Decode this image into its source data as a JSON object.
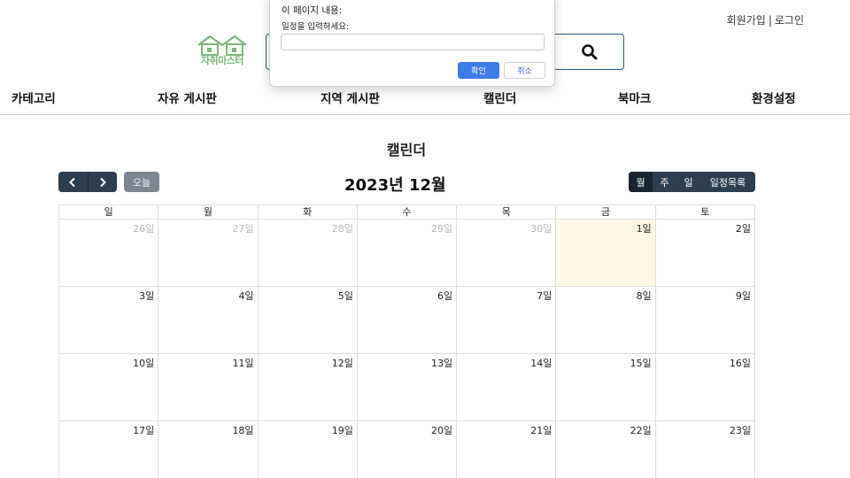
{
  "header": {
    "signup": "회원가입",
    "separator": "|",
    "login": "로그인",
    "logo_text": "자취마스터"
  },
  "nav": {
    "items": [
      "카테고리",
      "자유 게시판",
      "지역 게시판",
      "캘린더",
      "북마크",
      "환경설정"
    ]
  },
  "calendar": {
    "page_title": "캘린더",
    "today_label": "오늘",
    "month_title": "2023년 12월",
    "views": [
      "월",
      "주",
      "일",
      "일정목록"
    ],
    "active_view": "월",
    "weekdays": [
      "일",
      "월",
      "화",
      "수",
      "목",
      "금",
      "토"
    ],
    "weeks": [
      [
        {
          "label": "26일",
          "other": true
        },
        {
          "label": "27일",
          "other": true
        },
        {
          "label": "28일",
          "other": true
        },
        {
          "label": "29일",
          "other": true
        },
        {
          "label": "30일",
          "other": true
        },
        {
          "label": "1일",
          "today": true
        },
        {
          "label": "2일"
        }
      ],
      [
        {
          "label": "3일"
        },
        {
          "label": "4일"
        },
        {
          "label": "5일"
        },
        {
          "label": "6일"
        },
        {
          "label": "7일"
        },
        {
          "label": "8일"
        },
        {
          "label": "9일"
        }
      ],
      [
        {
          "label": "10일"
        },
        {
          "label": "11일"
        },
        {
          "label": "12일"
        },
        {
          "label": "13일"
        },
        {
          "label": "14일"
        },
        {
          "label": "15일"
        },
        {
          "label": "16일"
        }
      ],
      [
        {
          "label": "17일"
        },
        {
          "label": "18일"
        },
        {
          "label": "19일"
        },
        {
          "label": "20일"
        },
        {
          "label": "21일"
        },
        {
          "label": "22일"
        },
        {
          "label": "23일"
        }
      ]
    ]
  },
  "dialog": {
    "title": "이 페이지 내용:",
    "message": "일정을 입력하세요:",
    "input_value": "",
    "ok_label": "확인",
    "cancel_label": "취소"
  },
  "icons": {
    "search": "search-icon",
    "prev": "chevron-left-icon",
    "next": "chevron-right-icon"
  },
  "colors": {
    "brand_green": "#7cb87a",
    "toolbar_dark": "#2c3e50",
    "today_bg": "#fdf8e3",
    "dialog_ok": "#3f7ce8"
  }
}
